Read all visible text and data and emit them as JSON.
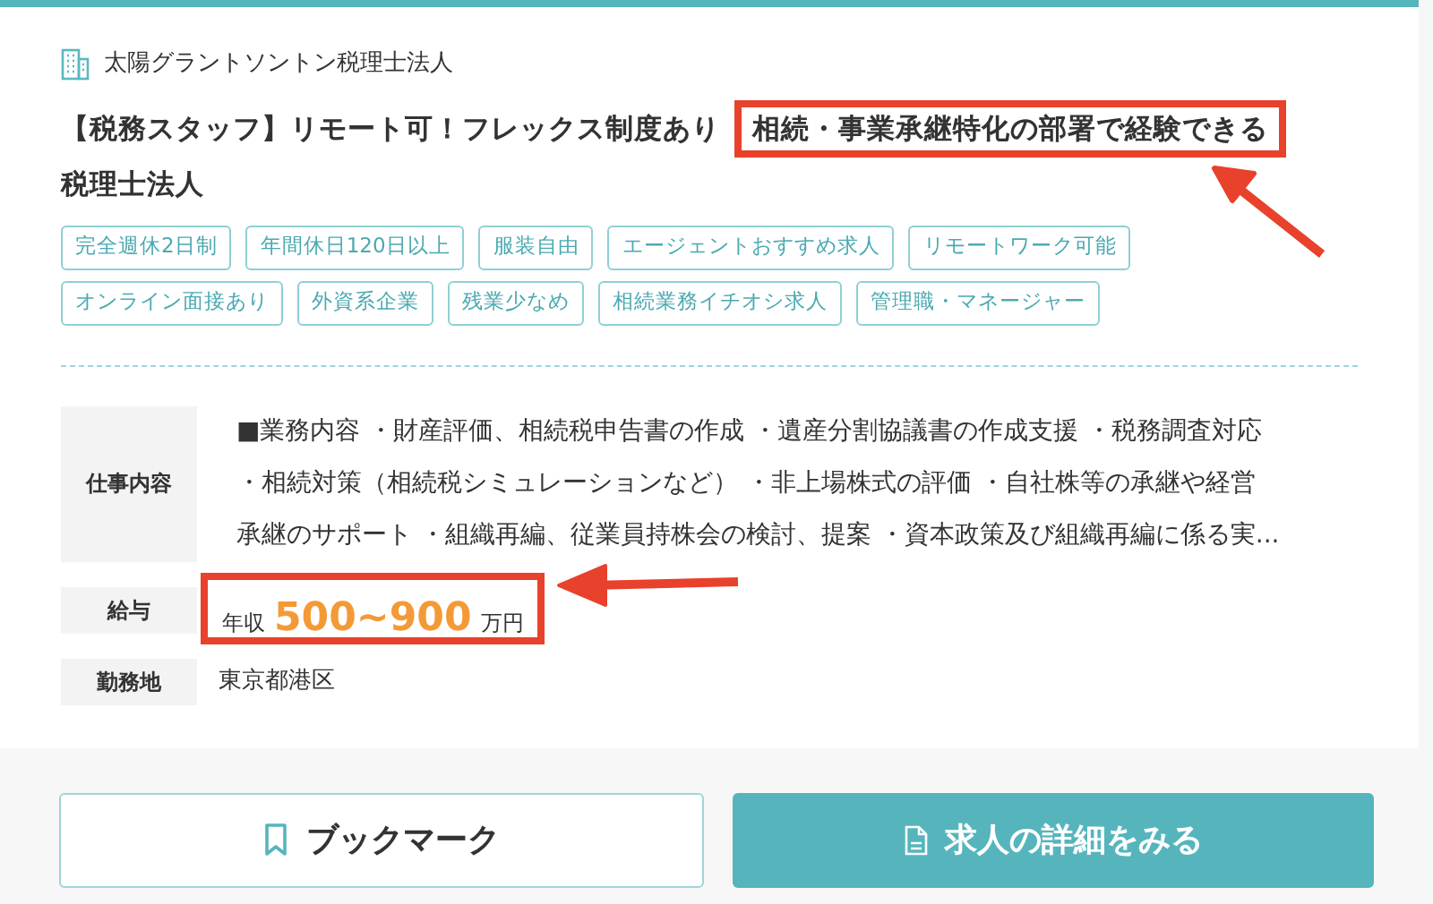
{
  "company": "太陽グラントソントン税理士法人",
  "title": [
    {
      "text": "【税務スタッフ】リモート可！フレックス制度あり",
      "highlighted": false
    },
    {
      "text": "相続・事業承継特化の部署で経験できる",
      "highlighted": true
    },
    {
      "text": "税理士法人",
      "highlighted": false
    }
  ],
  "tags": [
    "完全週休2日制",
    "年間休日120日以上",
    "服装自由",
    "エージェントおすすめ求人",
    "リモートワーク可能",
    "オンライン面接あり",
    "外資系企業",
    "残業少なめ",
    "相続業務イチオシ求人",
    "管理職・マネージャー"
  ],
  "details": [
    {
      "kind": "lines",
      "label": "仕事内容",
      "lines": [
        "■業務内容 ・財産評価、相続税申告書の作成 ・遺産分割協議書の作成支援 ・税務調査対応",
        "・相続対策（相続税シミュレーションなど） ・非上場株式の評価 ・自社株等の承継や経営",
        "承継のサポート ・組織再編、従業員持株会の検討、提案 ・資本政策及び組織再編に係る実..."
      ]
    },
    {
      "kind": "salary",
      "label": "給与",
      "prefix": "年収",
      "amount": "500~900",
      "unit": "万円",
      "highlighted": true
    },
    {
      "kind": "text",
      "label": "勤務地",
      "value": "東京都港区"
    }
  ],
  "buttons": [
    {
      "kind": "bookmark",
      "label": "ブックマーク"
    },
    {
      "kind": "details",
      "label": "求人の詳細をみる"
    }
  ]
}
